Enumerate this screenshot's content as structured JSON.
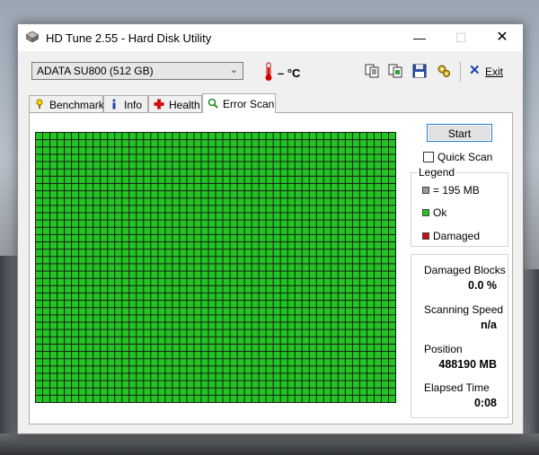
{
  "window": {
    "title": "HD Tune 2.55 - Hard Disk Utility"
  },
  "toolbar": {
    "drive": "ADATA SU800 (512 GB)",
    "temperature": "– °C",
    "exit_label": "Exit",
    "buttons": [
      "copy-info-icon",
      "copy-screen-icon",
      "save-icon",
      "options-icon"
    ]
  },
  "tabs": [
    {
      "label": "Benchmark",
      "icon": "benchmark-icon"
    },
    {
      "label": "Info",
      "icon": "info-icon"
    },
    {
      "label": "Health",
      "icon": "health-icon"
    },
    {
      "label": "Error Scan",
      "icon": "error-scan-icon",
      "active": true
    }
  ],
  "scan": {
    "start_label": "Start",
    "quick_scan_label": "Quick Scan",
    "quick_scan_checked": false,
    "grid_cols": 50,
    "grid_rows": 37,
    "block_color": "#22c522"
  },
  "legend": {
    "title": "Legend",
    "block_size": "= 195 MB",
    "ok": "Ok",
    "damaged": "Damaged",
    "colors": {
      "block": "#9a9a9a",
      "ok": "#22c522",
      "damaged": "#c81010"
    }
  },
  "stats": {
    "damaged_blocks_label": "Damaged Blocks",
    "damaged_blocks_value": "0.0 %",
    "scanning_speed_label": "Scanning Speed",
    "scanning_speed_value": "n/a",
    "position_label": "Position",
    "position_value": "488190 MB",
    "elapsed_label": "Elapsed Time",
    "elapsed_value": "0:08"
  }
}
